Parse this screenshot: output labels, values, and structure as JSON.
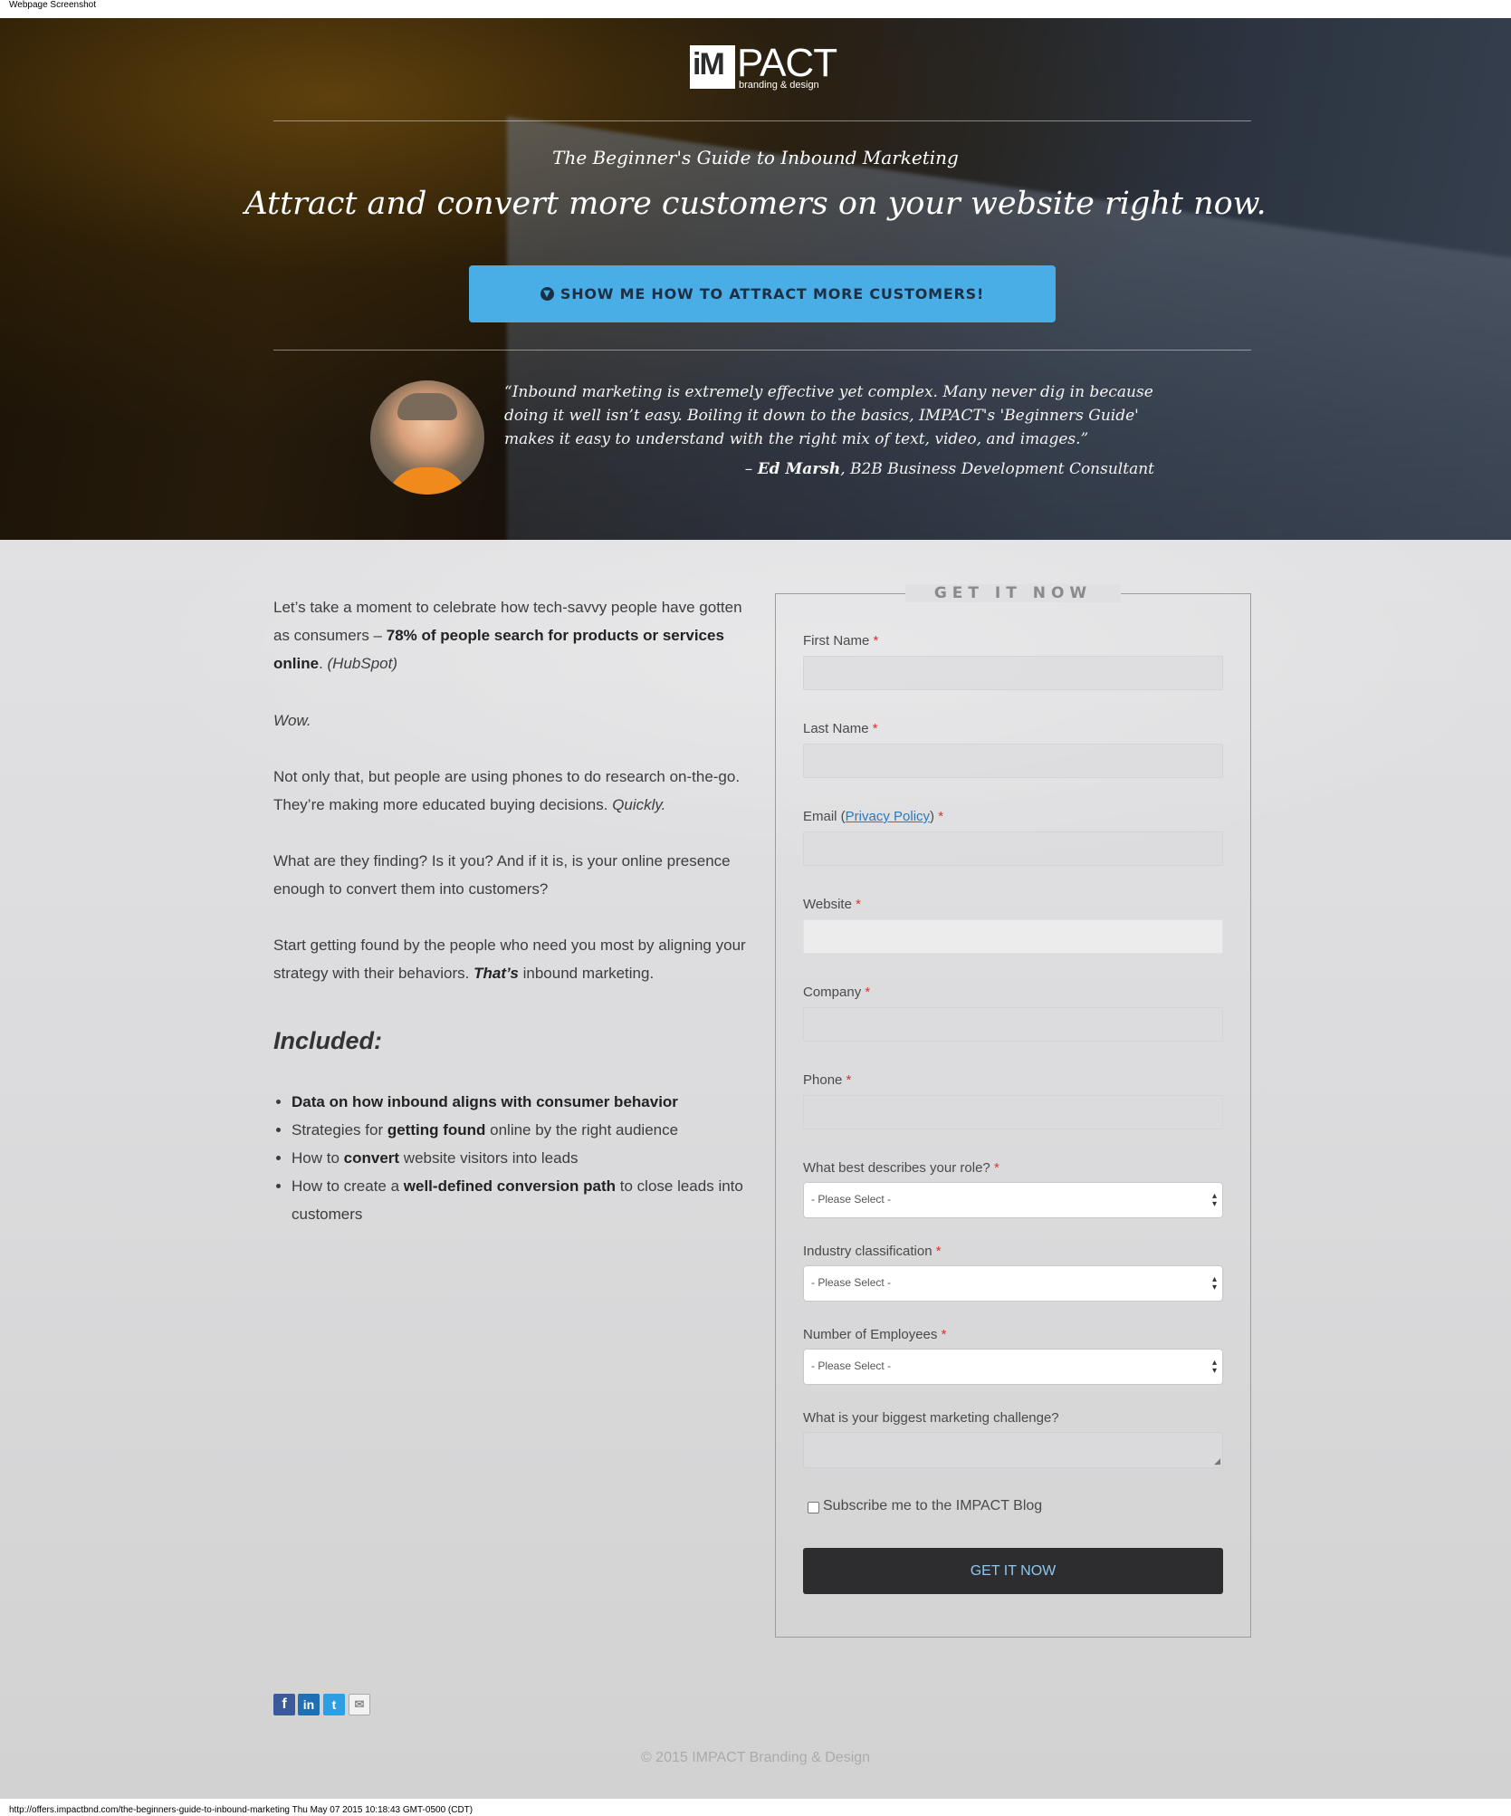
{
  "screenshot_title": "Webpage Screenshot",
  "brand": {
    "logo_left": "iM",
    "logo_right": "PACT",
    "logo_tagline": "branding & design"
  },
  "hero": {
    "subtitle": "The Beginner's Guide to Inbound Marketing",
    "title": "Attract and convert more customers on your website right now.",
    "cta_label": "SHOW ME HOW TO ATTRACT MORE CUSTOMERS!",
    "quote": "“Inbound marketing is extremely effective yet complex. Many never dig in because doing it well isn’t easy. Boiling it down to the basics, IMPACT's 'Beginners Guide' makes it easy to understand with the right mix of text, video, and images.”",
    "attribution_dash": "– ",
    "attribution_name": "Ed Marsh",
    "attribution_role": ", B2B Business Development Consultant"
  },
  "content": {
    "p1_a": "Let’s take a moment to celebrate how tech-savvy people have gotten as consumers – ",
    "p1_b": "78% of people search for products or services online",
    "p1_c": ". ",
    "p1_d": "(HubSpot)",
    "p2": "Wow.",
    "p3_a": "Not only that, but people are using phones to do research on-the-go. They’re making more educated buying decisions. ",
    "p3_b": "Quickly.",
    "p4": "What are they finding? Is it you? And if it is, is your online presence enough to convert them into customers?",
    "p5_a": "Start getting found by the people who need you most by aligning your strategy with their behaviors. ",
    "p5_b": "That’s",
    "p5_c": " inbound marketing.",
    "included_heading": "Included:",
    "bullets": [
      {
        "pre": "",
        "bold": "Data on how inbound aligns with consumer behavior",
        "post": ""
      },
      {
        "pre": "Strategies for ",
        "bold": "getting found",
        "post": " online by the right audience"
      },
      {
        "pre": "How to ",
        "bold": "convert",
        "post": " website visitors into leads"
      },
      {
        "pre": "How to create a ",
        "bold": "well-defined conversion path",
        "post": " to close leads into customers"
      }
    ]
  },
  "form": {
    "legend": "GET IT NOW",
    "required_mark": "*",
    "first_name": "First Name",
    "last_name": "Last Name",
    "email_prefix": "Email (",
    "privacy_link": "Privacy Policy",
    "email_suffix": ")",
    "website": "Website",
    "company": "Company",
    "phone": "Phone",
    "role_label": "What best describes your role?",
    "industry_label": "Industry classification",
    "employees_label": "Number of Employees",
    "select_value": "- Please Select -",
    "challenge_label": "What is your biggest marketing challenge?",
    "subscribe_label": "Subscribe me to the IMPACT Blog",
    "submit_label": "GET IT NOW"
  },
  "social": {
    "facebook": "f",
    "linkedin": "in",
    "twitter": "t",
    "email": "✉"
  },
  "footer": {
    "copyright": "© 2015 IMPACT Branding & Design",
    "url_line": "http://offers.impactbnd.com/the-beginners-guide-to-inbound-marketing Thu May 07 2015 10:18:43 GMT-0500 (CDT)"
  },
  "colors": {
    "cta": "#4aaee6",
    "submit": "#2d2d2f",
    "required": "#d9342b",
    "link": "#2a7ab8"
  }
}
